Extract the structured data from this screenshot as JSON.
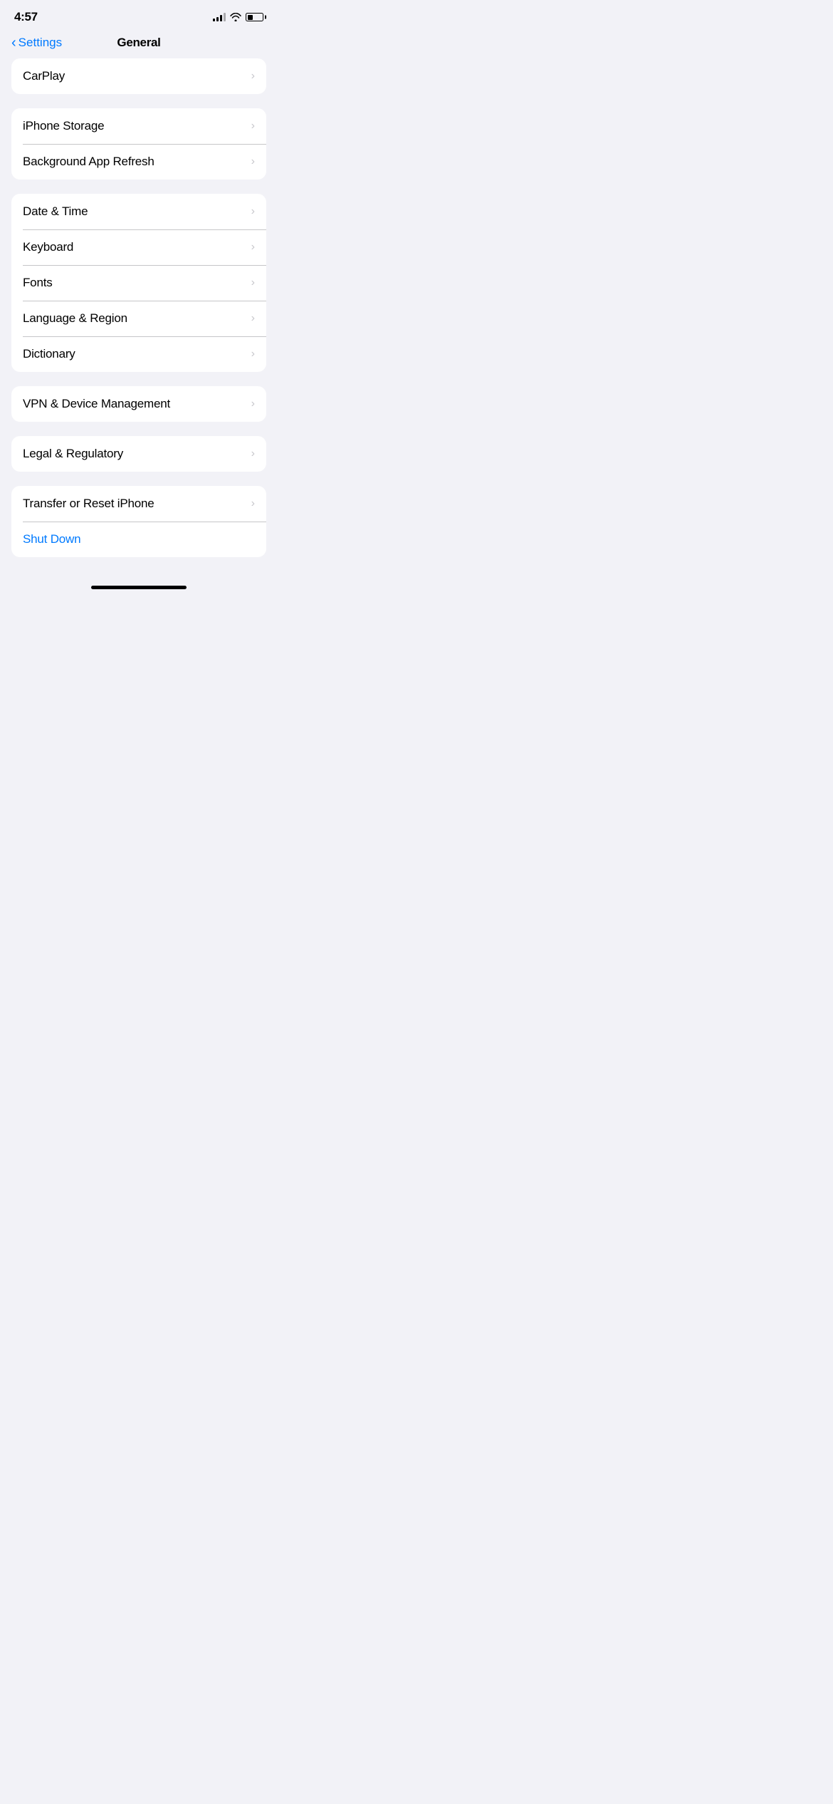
{
  "statusBar": {
    "time": "4:57",
    "signalBars": 3,
    "wifiOn": true,
    "batteryLevel": 35
  },
  "navBar": {
    "backLabel": "Settings",
    "title": "General"
  },
  "groups": [
    {
      "id": "carplay-group",
      "rows": [
        {
          "id": "carplay",
          "label": "CarPlay",
          "hasChevron": true,
          "labelStyle": ""
        }
      ]
    },
    {
      "id": "storage-group",
      "rows": [
        {
          "id": "iphone-storage",
          "label": "iPhone Storage",
          "hasChevron": true,
          "labelStyle": ""
        },
        {
          "id": "background-app-refresh",
          "label": "Background App Refresh",
          "hasChevron": true,
          "labelStyle": ""
        }
      ]
    },
    {
      "id": "locale-group",
      "rows": [
        {
          "id": "date-time",
          "label": "Date & Time",
          "hasChevron": true,
          "labelStyle": ""
        },
        {
          "id": "keyboard",
          "label": "Keyboard",
          "hasChevron": true,
          "labelStyle": ""
        },
        {
          "id": "fonts",
          "label": "Fonts",
          "hasChevron": true,
          "labelStyle": ""
        },
        {
          "id": "language-region",
          "label": "Language & Region",
          "hasChevron": true,
          "labelStyle": ""
        },
        {
          "id": "dictionary",
          "label": "Dictionary",
          "hasChevron": true,
          "labelStyle": ""
        }
      ]
    },
    {
      "id": "vpn-group",
      "rows": [
        {
          "id": "vpn-device",
          "label": "VPN & Device Management",
          "hasChevron": true,
          "labelStyle": ""
        }
      ]
    },
    {
      "id": "legal-group",
      "rows": [
        {
          "id": "legal-regulatory",
          "label": "Legal & Regulatory",
          "hasChevron": true,
          "labelStyle": ""
        }
      ]
    },
    {
      "id": "reset-group",
      "rows": [
        {
          "id": "transfer-reset",
          "label": "Transfer or Reset iPhone",
          "hasChevron": true,
          "labelStyle": ""
        },
        {
          "id": "shut-down",
          "label": "Shut Down",
          "hasChevron": false,
          "labelStyle": "blue"
        }
      ]
    }
  ],
  "chevronChar": "›",
  "backChevron": "‹"
}
